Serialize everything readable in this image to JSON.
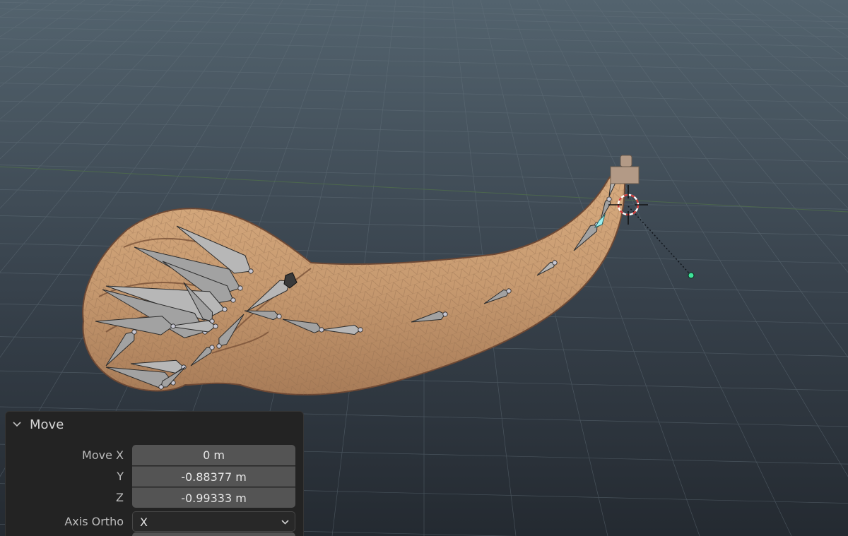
{
  "operator_panel": {
    "title": "Move",
    "chevron_icon": "chevron-down-icon",
    "move_x": {
      "label": "Move X",
      "value": "0 m"
    },
    "move_y": {
      "label": "Y",
      "value": "-0.88377 m"
    },
    "move_z": {
      "label": "Z",
      "value": "-0.99333 m"
    },
    "axis_ortho": {
      "label": "Axis Ortho",
      "value": "X"
    }
  },
  "colors": {
    "viewport_top": "#53636e",
    "viewport_bottom": "#242a31",
    "mesh_skin": "#c79a70",
    "bone": "#a9a9a9",
    "panel_bg": "#232323",
    "field_bg": "#545454"
  }
}
